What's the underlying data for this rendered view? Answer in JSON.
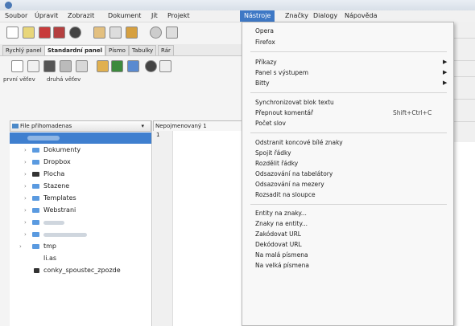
{
  "menubar": {
    "items": [
      "Soubor",
      "Úpravit",
      "Zobrazit",
      "Dokument",
      "Jít",
      "Projekt",
      "Nástroje",
      "Značky",
      "Dialogy",
      "Nápověda"
    ],
    "active_index": 6
  },
  "toolbar_tabs": [
    "Rychlý panel",
    "Standardní panel",
    "Písmo",
    "Tabulky",
    "Rár"
  ],
  "bookmarks": [
    "první věťev",
    "druhá věťev"
  ],
  "file_panel": {
    "header": "File přihomadenas",
    "items": [
      {
        "label": "Dokumenty",
        "expanded": false
      },
      {
        "label": "Dropbox",
        "expanded": false
      },
      {
        "label": "Plocha",
        "expanded": false
      },
      {
        "label": "Stazene",
        "expanded": false
      },
      {
        "label": "Templates",
        "expanded": false
      },
      {
        "label": "Webstrani",
        "expanded": false
      },
      {
        "label": "",
        "expanded": false
      },
      {
        "label": "",
        "expanded": false
      },
      {
        "label": "tmp",
        "expanded": false
      },
      {
        "label": "li.as",
        "expanded": false
      },
      {
        "label": "conky_spoustec_zpozde",
        "expanded": false
      }
    ]
  },
  "editor": {
    "tab": "Nepojmenovaný 1",
    "line_number": "1"
  },
  "dropdown": {
    "items": [
      {
        "label": "Opera"
      },
      {
        "label": "Firefox"
      },
      {
        "sep": true
      },
      {
        "label": "Příkazy",
        "submenu": true
      },
      {
        "label": "Panel s výstupem",
        "submenu": true
      },
      {
        "label": "Bitty",
        "submenu": true
      },
      {
        "sep": true
      },
      {
        "label": "Synchronizovat blok textu"
      },
      {
        "label": "Přepnout komentář",
        "shortcut": "Shift+Ctrl+C"
      },
      {
        "label": "Počet slov"
      },
      {
        "sep": true
      },
      {
        "label": "Odstranit koncové bílé znaky"
      },
      {
        "label": "Spojit řádky"
      },
      {
        "label": "Rozdělit řádky"
      },
      {
        "label": "Odsazování na tabelátory"
      },
      {
        "label": "Odsazování na mezery"
      },
      {
        "label": "Rozsadit na sloupce"
      },
      {
        "sep": true
      },
      {
        "label": "Entity na znaky..."
      },
      {
        "label": "Znaky na entity..."
      },
      {
        "label": "Zakódovat URL"
      },
      {
        "label": "Dekódovat URL"
      },
      {
        "label": "Na malá písmena"
      },
      {
        "label": "Na velká písmena"
      }
    ]
  },
  "colors": {
    "accent": "#3e78c5",
    "folder": "#5a9ae0"
  }
}
